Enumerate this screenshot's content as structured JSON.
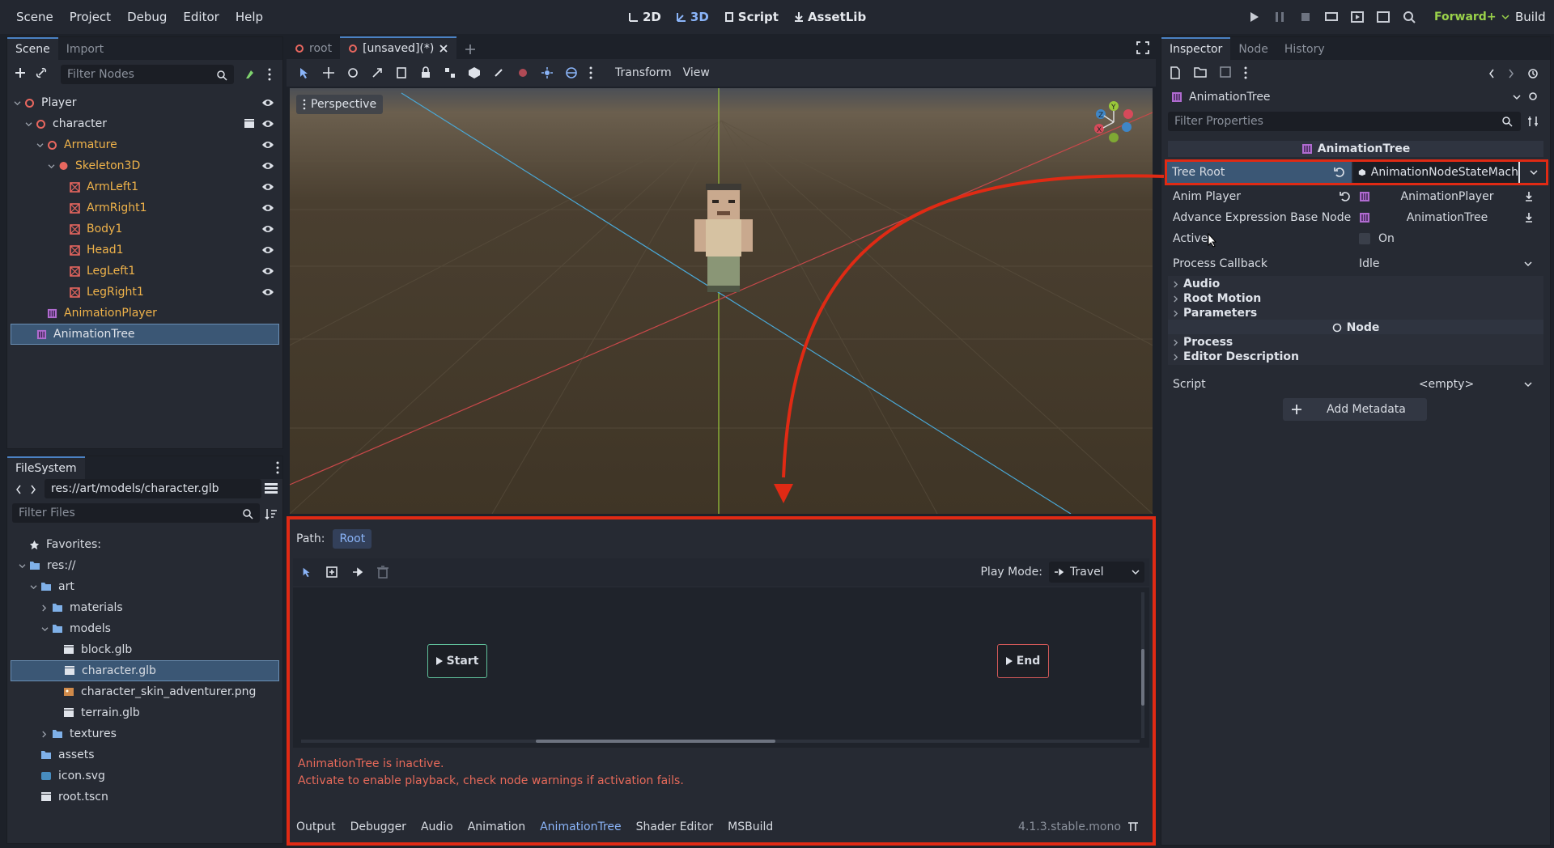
{
  "menu": [
    "Scene",
    "Project",
    "Debug",
    "Editor",
    "Help"
  ],
  "modes": {
    "m2d": "2D",
    "m3d": "3D",
    "script": "Script",
    "assetlib": "AssetLib"
  },
  "renderer": "Forward+",
  "build": "Build",
  "scene_panel": {
    "tabs": [
      "Scene",
      "Import"
    ],
    "filter_placeholder": "Filter Nodes",
    "nodes": [
      {
        "label": "Player",
        "color": "#dfe3ea",
        "eye": true
      },
      {
        "label": "character",
        "color": "#dfe3ea",
        "eye": true
      },
      {
        "label": "Armature",
        "color": "#f0b34a",
        "eye": true
      },
      {
        "label": "Skeleton3D",
        "color": "#f0b34a",
        "eye": true
      },
      {
        "label": "ArmLeft1",
        "color": "#f0b34a",
        "eye": true
      },
      {
        "label": "ArmRight1",
        "color": "#f0b34a",
        "eye": true
      },
      {
        "label": "Body1",
        "color": "#f0b34a",
        "eye": true
      },
      {
        "label": "Head1",
        "color": "#f0b34a",
        "eye": true
      },
      {
        "label": "LegLeft1",
        "color": "#f0b34a",
        "eye": true
      },
      {
        "label": "LegRight1",
        "color": "#f0b34a",
        "eye": true
      },
      {
        "label": "AnimationPlayer",
        "color": "#f0b34a",
        "eye": false
      },
      {
        "label": "AnimationTree",
        "color": "#dfe3ea",
        "eye": false
      }
    ]
  },
  "filesystem": {
    "title": "FileSystem",
    "path": "res://art/models/character.glb",
    "filter_placeholder": "Filter Files",
    "items": [
      {
        "label": "Favorites:"
      },
      {
        "label": "res://"
      },
      {
        "label": "art"
      },
      {
        "label": "materials"
      },
      {
        "label": "models"
      },
      {
        "label": "block.glb"
      },
      {
        "label": "character.glb"
      },
      {
        "label": "character_skin_adventurer.png"
      },
      {
        "label": "terrain.glb"
      },
      {
        "label": "textures"
      },
      {
        "label": "assets"
      },
      {
        "label": "icon.svg"
      },
      {
        "label": "root.tscn"
      }
    ]
  },
  "viewport": {
    "tabs": [
      "root",
      "[unsaved](*)"
    ],
    "toolbar": {
      "transform": "Transform",
      "view": "View"
    },
    "perspective": "Perspective"
  },
  "anim_tree_editor": {
    "path_label": "Path:",
    "path_root": "Root",
    "play_mode_label": "Play Mode:",
    "play_mode_value": "Travel",
    "start": "Start",
    "end": "End",
    "warning1": "AnimationTree is inactive.",
    "warning2": "Activate to enable playback, check node warnings if activation fails."
  },
  "bottom_tabs": [
    "Output",
    "Debugger",
    "Audio",
    "Animation",
    "AnimationTree",
    "Shader Editor",
    "MSBuild"
  ],
  "version": "4.1.3.stable.mono",
  "inspector": {
    "tabs": [
      "Inspector",
      "Node",
      "History"
    ],
    "node_name": "AnimationTree",
    "filter_placeholder": "Filter Properties",
    "section": "AnimationTree",
    "tree_root_label": "Tree Root",
    "tree_root_value": "AnimationNodeStateMach",
    "anim_player_label": "Anim Player",
    "anim_player_value": "AnimationPlayer",
    "adv_expr_label": "Advance Expression Base Node",
    "adv_expr_value": "AnimationTree",
    "active_label": "Active",
    "active_value": "On",
    "process_callback_label": "Process Callback",
    "process_callback_value": "Idle",
    "cats1": [
      "Audio",
      "Root Motion",
      "Parameters"
    ],
    "node_section": "Node",
    "cats2": [
      "Process",
      "Editor Description"
    ],
    "script_label": "Script",
    "script_value": "<empty>",
    "add_metadata": "Add Metadata"
  },
  "colors": {
    "accent": "#8ab4f8",
    "highlight_red": "#e02a14",
    "selection": "#3b5775"
  }
}
